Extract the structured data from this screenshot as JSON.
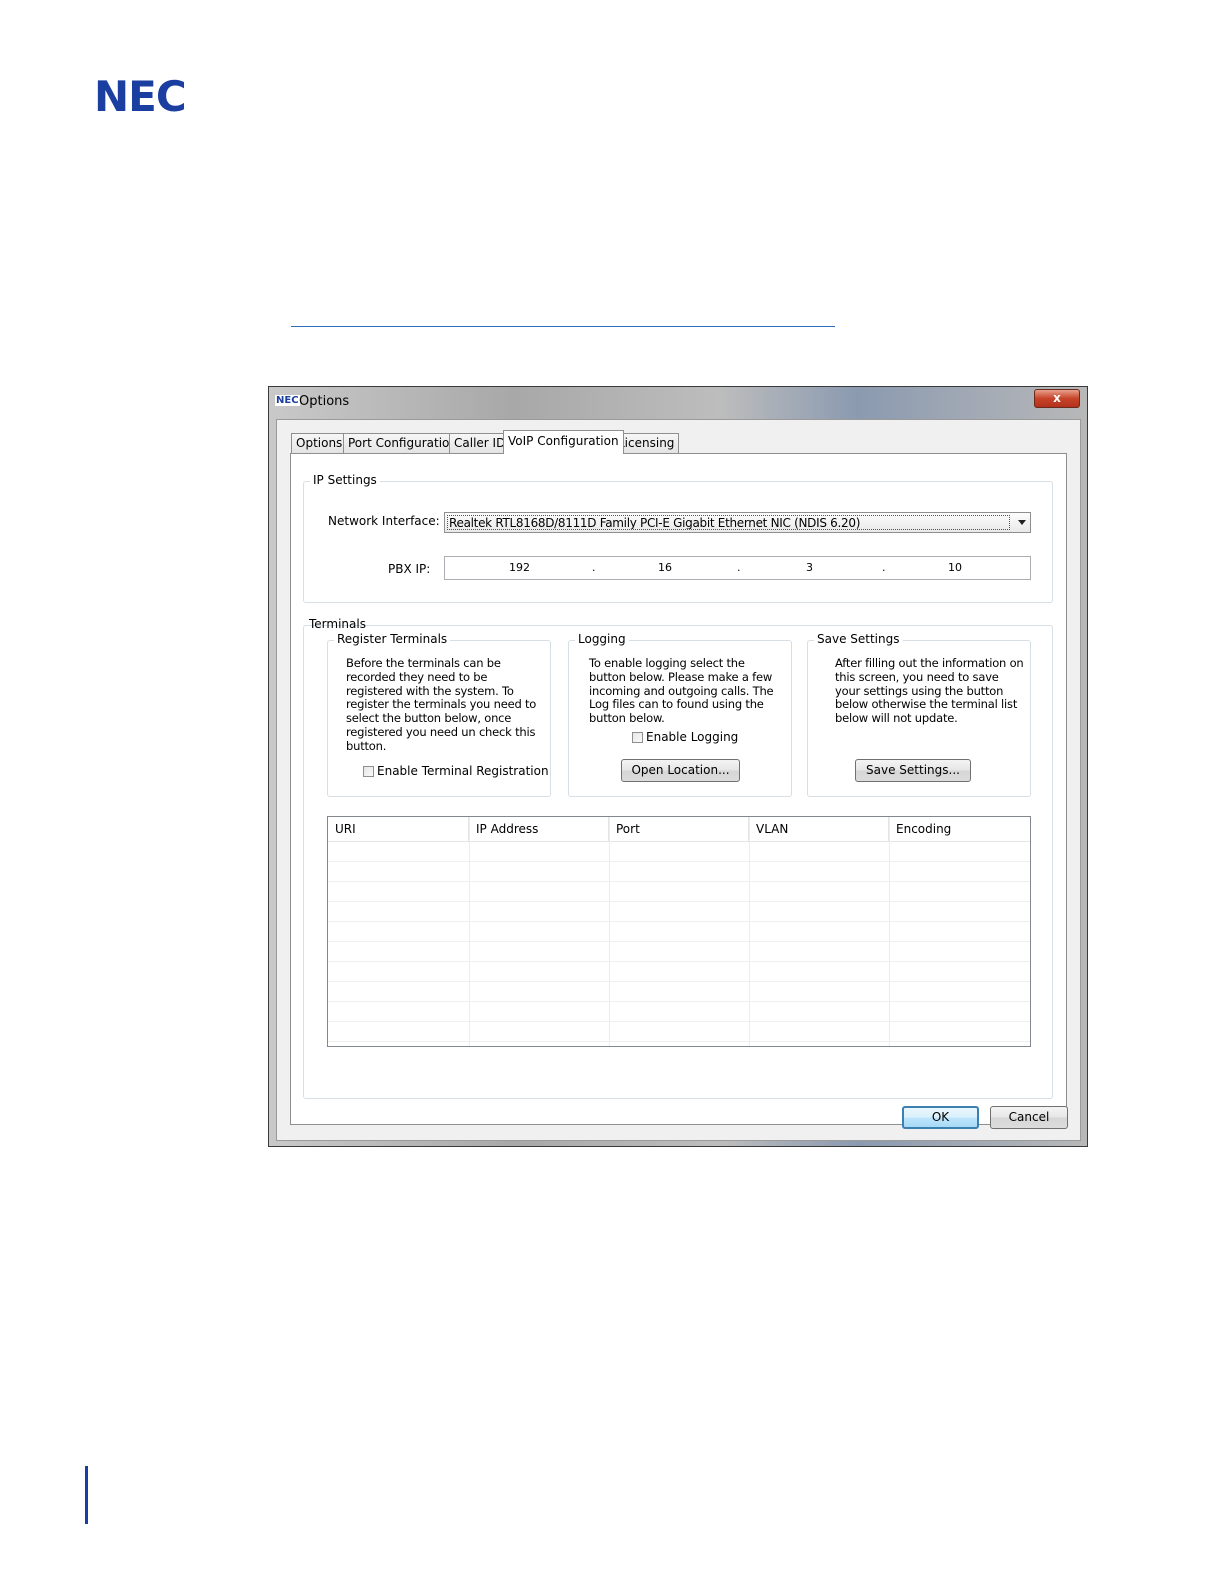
{
  "page": {
    "logo_text": "NEC"
  },
  "window": {
    "title_icon_text": "NEC",
    "title": "Options",
    "close_label": "x"
  },
  "tabs": [
    {
      "label": "Options",
      "active": false
    },
    {
      "label": "Port Configuration",
      "active": false
    },
    {
      "label": "Caller ID",
      "active": false
    },
    {
      "label": "VoIP Configuration",
      "active": true
    },
    {
      "label": "Licensing",
      "active": false
    }
  ],
  "ip_settings": {
    "group_label": "IP Settings",
    "network_interface_label": "Network Interface:",
    "network_interface_value": "Realtek RTL8168D/8111D Family PCI-E Gigabit Ethernet NIC (NDIS 6.20)",
    "pbx_ip_label": "PBX IP:",
    "pbx_ip": [
      "192",
      "16",
      "3",
      "10"
    ],
    "ip_separator": "."
  },
  "terminals": {
    "group_label": "Terminals",
    "register": {
      "label": "Register Terminals",
      "description": "Before the terminals can be recorded they need to be registered with the system. To register the terminals you need to select the button below, once registered you need un check this button.",
      "checkbox_label": "Enable Terminal Registration",
      "checked": false
    },
    "logging": {
      "label": "Logging",
      "description": "To enable logging select the button below. Please make a few incoming and outgoing calls. The Log files can to found using the button below.",
      "checkbox_label": "Enable Logging",
      "checked": false,
      "button_label": "Open Location..."
    },
    "save": {
      "label": "Save Settings",
      "description": "After filling out the information on this screen, you need  to save your settings using the button below otherwise the terminal list below will not update.",
      "button_label": "Save Settings..."
    },
    "table": {
      "columns": [
        "URI",
        "IP Address",
        "Port",
        "VLAN",
        "Encoding"
      ]
    }
  },
  "footer": {
    "ok_label": "OK",
    "cancel_label": "Cancel"
  }
}
